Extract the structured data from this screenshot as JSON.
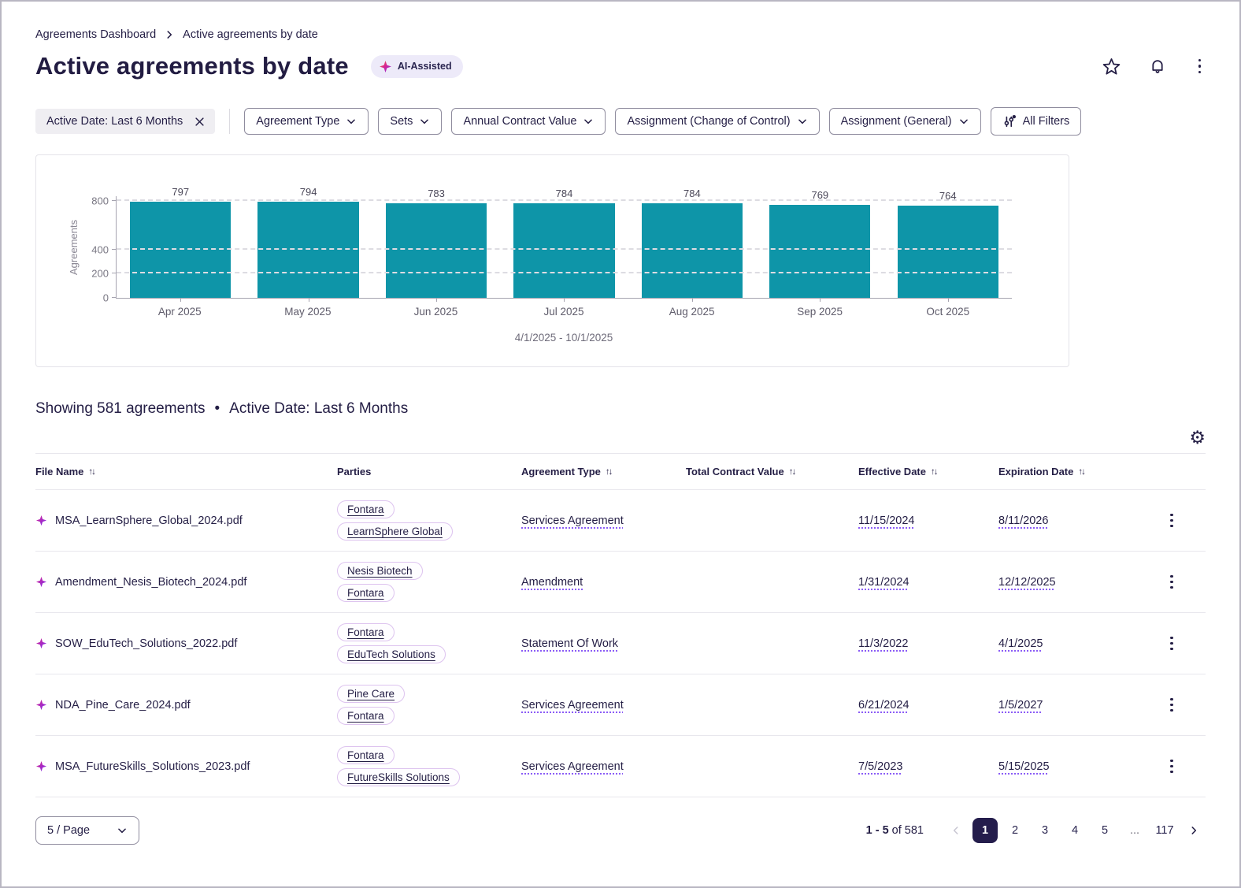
{
  "breadcrumb": {
    "parent": "Agreements Dashboard",
    "current": "Active agreements by date"
  },
  "header": {
    "title": "Active agreements by date",
    "badge": "AI-Assisted"
  },
  "filters": {
    "active_chip": "Active Date: Last 6 Months",
    "dropdowns": [
      "Agreement Type",
      "Sets",
      "Annual Contract Value",
      "Assignment (Change of Control)",
      "Assignment (General)"
    ],
    "all_filters": "All Filters"
  },
  "chart_data": {
    "type": "bar",
    "categories": [
      "Apr 2025",
      "May 2025",
      "Jun 2025",
      "Jul 2025",
      "Aug 2025",
      "Sep 2025",
      "Oct 2025"
    ],
    "values": [
      797,
      794,
      783,
      784,
      784,
      769,
      764
    ],
    "ylabel": "Agreements",
    "yticks": [
      0,
      200,
      400,
      800
    ],
    "ylim": [
      0,
      840
    ],
    "grid": "dashed horizontal at yticks",
    "subtitle": "4/1/2025 - 10/1/2025",
    "bar_color": "#0e95a8"
  },
  "summary": {
    "showing": "Showing 581 agreements",
    "dot": "•",
    "filter": "Active Date: Last 6 Months"
  },
  "table": {
    "columns": [
      {
        "label": "File Name",
        "sortable": true
      },
      {
        "label": "Parties",
        "sortable": false
      },
      {
        "label": "Agreement Type",
        "sortable": true
      },
      {
        "label": "Total Contract Value",
        "sortable": true
      },
      {
        "label": "Effective Date",
        "sortable": true
      },
      {
        "label": "Expiration Date",
        "sortable": true
      }
    ],
    "rows": [
      {
        "file": "MSA_LearnSphere_Global_2024.pdf",
        "parties": [
          "Fontara",
          "LearnSphere Global"
        ],
        "type": "Services Agreement",
        "tcv": "",
        "effective": "11/15/2024",
        "expiration": "8/11/2026"
      },
      {
        "file": "Amendment_Nesis_Biotech_2024.pdf",
        "parties": [
          "Nesis Biotech",
          "Fontara"
        ],
        "type": "Amendment",
        "tcv": "",
        "effective": "1/31/2024",
        "expiration": "12/12/2025"
      },
      {
        "file": "SOW_EduTech_Solutions_2022.pdf",
        "parties": [
          "Fontara",
          "EduTech Solutions"
        ],
        "type": "Statement Of Work",
        "tcv": "",
        "effective": "11/3/2022",
        "expiration": "4/1/2025"
      },
      {
        "file": "NDA_Pine_Care_2024.pdf",
        "parties": [
          "Pine Care",
          "Fontara"
        ],
        "type": "Services Agreement",
        "tcv": "",
        "effective": "6/21/2024",
        "expiration": "1/5/2027"
      },
      {
        "file": "MSA_FutureSkills_Solutions_2023.pdf",
        "parties": [
          "Fontara",
          "FutureSkills Solutions"
        ],
        "type": "Services Agreement",
        "tcv": "",
        "effective": "7/5/2023",
        "expiration": "5/15/2025"
      }
    ]
  },
  "pagination": {
    "page_size": "5 / Page",
    "range_bold": "1 - 5",
    "range_rest": "of 581",
    "pages": [
      "1",
      "2",
      "3",
      "4",
      "5",
      "...",
      "117"
    ],
    "active_page": "1"
  },
  "icons": {
    "favorite": "star-outline",
    "notifications": "bell-outline",
    "more": "kebab-dots",
    "settings": "gear",
    "close": "x",
    "dropdown": "chevron-down",
    "sort": "up-down-arrows",
    "ai": "four-point-sparkle",
    "file_marker": "four-point-sparkle",
    "all_filters": "sliders-with-dot"
  },
  "colors": {
    "bar_teal": "#0e95a8",
    "navy_text": "#241e45",
    "accent_purple": "#8b5cf6",
    "active_page_bg": "#241d4c",
    "badge_bg": "#edeaf9",
    "pill_border": "#ddc3ef"
  }
}
